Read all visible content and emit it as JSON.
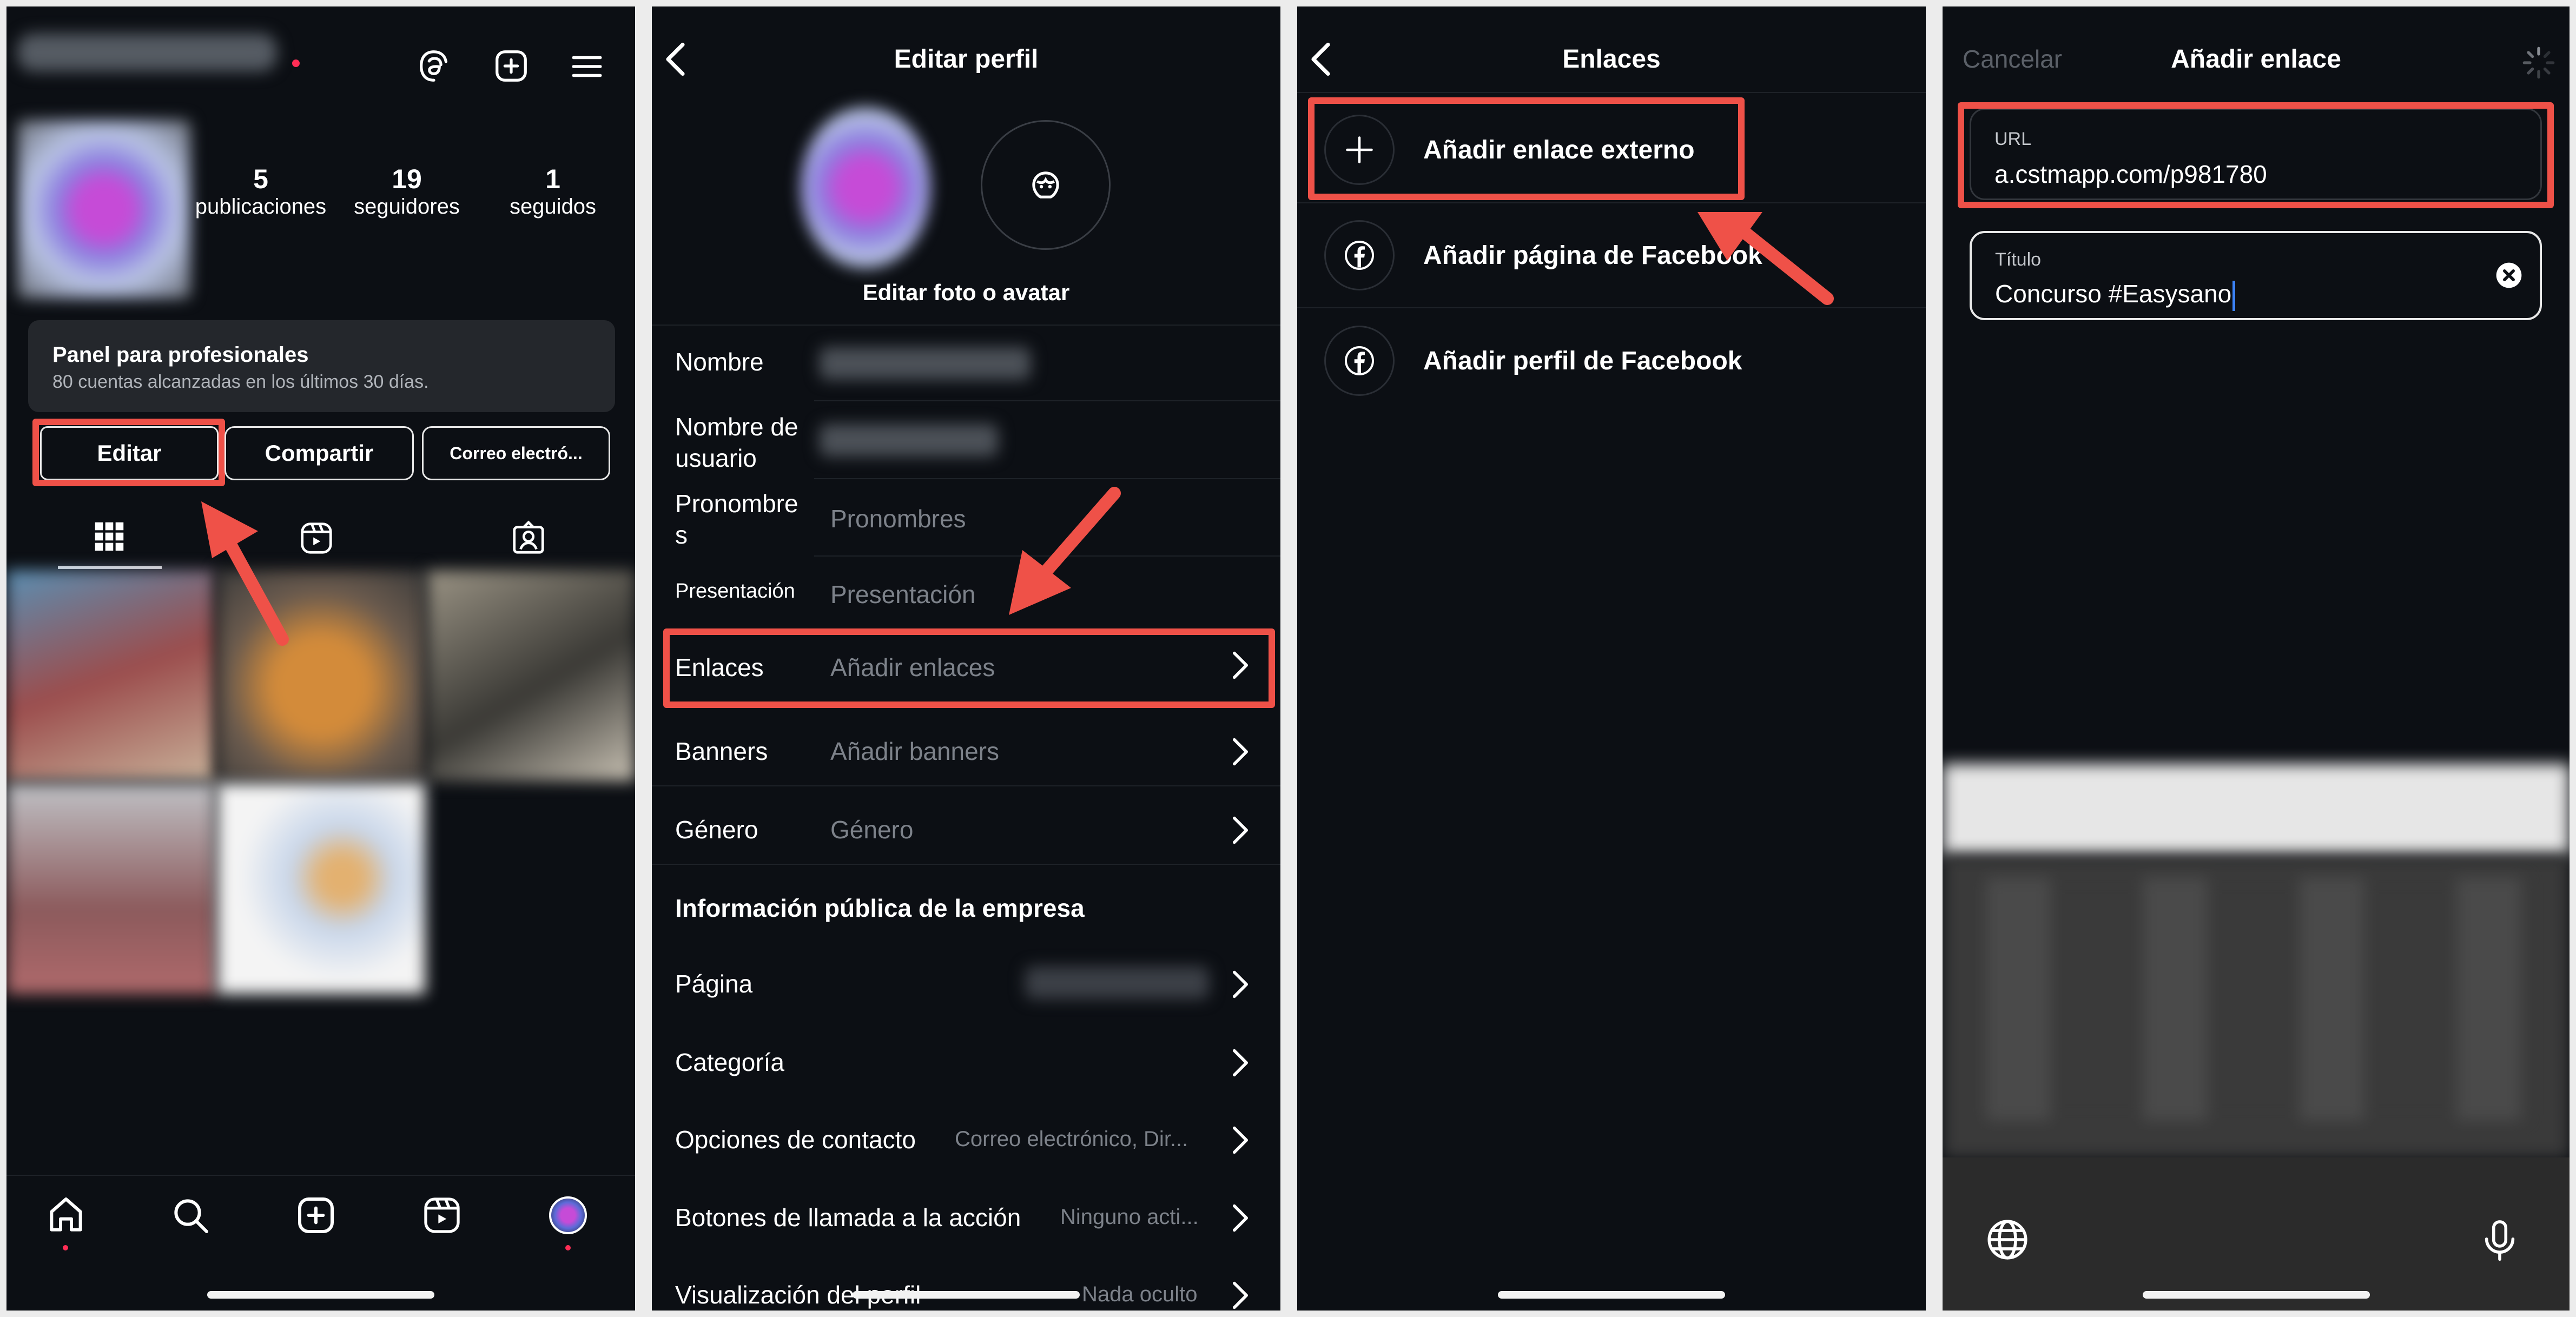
{
  "p1": {
    "stats": [
      {
        "value": "5",
        "label": "publicaciones"
      },
      {
        "value": "19",
        "label": "seguidores"
      },
      {
        "value": "1",
        "label": "seguidos"
      }
    ],
    "dashboard_title": "Panel para profesionales",
    "dashboard_subtitle": "80 cuentas alcanzadas en los últimos 30 días.",
    "btn_edit": "Editar",
    "btn_share": "Compartir",
    "btn_email": "Correo electró..."
  },
  "p2": {
    "back": "<",
    "title": "Editar perfil",
    "edit_photo": "Editar foto o avatar",
    "name_label": "Nombre",
    "username_label": "Nombre de usuario",
    "pronouns_label": "Pronombres",
    "pronouns_ph": "Pronombres",
    "bio_label": "Presentación",
    "bio_ph": "Presentación",
    "links_label": "Enlaces",
    "links_ph": "Añadir enlaces",
    "banners_label": "Banners",
    "banners_ph": "Añadir banners",
    "gender_label": "Género",
    "gender_ph": "Género",
    "section": "Información pública de la empresa",
    "page_label": "Página",
    "category_label": "Categoría",
    "contact_label": "Opciones de contacto",
    "contact_value": "Correo electrónico, Dir...",
    "cta_label": "Botones de llamada a la acción",
    "cta_value": "Ninguno acti...",
    "display_label": "Visualización del perfil",
    "display_value": "Nada oculto"
  },
  "p3": {
    "title": "Enlaces",
    "add_external": "Añadir enlace externo",
    "add_fb_page": "Añadir página de Facebook",
    "add_fb_profile": "Añadir perfil de Facebook"
  },
  "p4": {
    "cancel": "Cancelar",
    "title": "Añadir enlace",
    "url_label": "URL",
    "url_value": "a.cstmapp.com/p981780",
    "title_label": "Título",
    "title_value": "Concurso #Easysano"
  },
  "colors": {
    "accent_red": "#ef5148",
    "background": "#0c0f14",
    "muted": "#7d828a",
    "notif": "#ff2d55"
  }
}
